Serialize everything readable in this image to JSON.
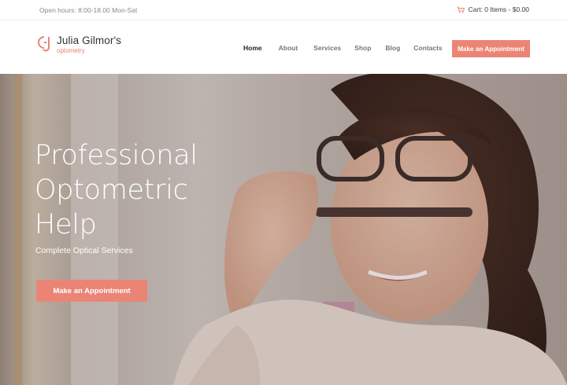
{
  "topbar": {
    "hours": "Open hours: 8:00-18.00 Mon-Sat",
    "cart_label": "Cart: 0 Items - $0.00",
    "cart_icon": "cart-icon"
  },
  "brand": {
    "name": "Julia Gilmor's",
    "tagline": "optometry",
    "accent": "#ea8576"
  },
  "nav": {
    "items": [
      {
        "label": "Home",
        "active": true
      },
      {
        "label": "About",
        "active": false
      },
      {
        "label": "Services",
        "active": false
      },
      {
        "label": "Shop",
        "active": false
      },
      {
        "label": "Blog",
        "active": false
      },
      {
        "label": "Contacts",
        "active": false
      }
    ],
    "cta_label": "Make an Appointment"
  },
  "hero": {
    "title_lines": [
      "Professional",
      "Optometric",
      "Help"
    ],
    "subtitle": "Complete Optical Services",
    "cta_label": "Make an Appointment"
  }
}
